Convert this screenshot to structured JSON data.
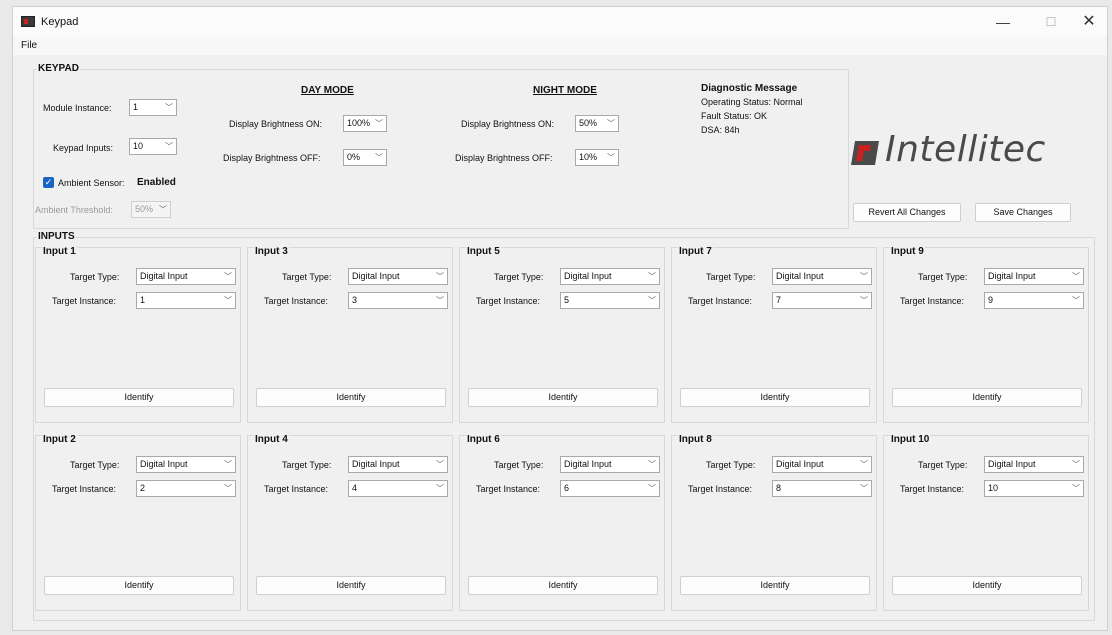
{
  "window": {
    "title": "Keypad",
    "minimize": "—",
    "maximize": "☐",
    "close": "✕"
  },
  "menu": {
    "file": "File"
  },
  "keypad": {
    "label": "KEYPAD",
    "module_instance_label": "Module Instance:",
    "module_instance_value": "1",
    "keypad_inputs_label": "Keypad Inputs:",
    "keypad_inputs_value": "10",
    "ambient_sensor_label": "Ambient Sensor:",
    "ambient_sensor_status": "Enabled",
    "ambient_threshold_label": "Ambient Threshold:",
    "ambient_threshold_value": "50%",
    "day_mode": {
      "title": "DAY MODE",
      "on_label": "Display Brightness ON:",
      "on_value": "100%",
      "off_label": "Display Brightness OFF:",
      "off_value": "0%"
    },
    "night_mode": {
      "title": "NIGHT MODE",
      "on_label": "Display Brightness ON:",
      "on_value": "50%",
      "off_label": "Display Brightness OFF:",
      "off_value": "10%"
    },
    "diagnostic": {
      "title": "Diagnostic Message",
      "operating_status": "Operating Status: Normal",
      "fault_status": "Fault Status: OK",
      "dsa": "DSA: 84h"
    }
  },
  "logo_text": "Intellitec",
  "buttons": {
    "revert": "Revert All Changes",
    "save": "Save Changes"
  },
  "inputs": {
    "label": "INPUTS",
    "target_type_label": "Target Type:",
    "target_instance_label": "Target Instance:",
    "identify_label": "Identify",
    "items": [
      {
        "title": "Input 1",
        "target_type": "Digital Input",
        "target_instance": "1"
      },
      {
        "title": "Input 2",
        "target_type": "Digital Input",
        "target_instance": "2"
      },
      {
        "title": "Input 3",
        "target_type": "Digital Input",
        "target_instance": "3"
      },
      {
        "title": "Input 4",
        "target_type": "Digital Input",
        "target_instance": "4"
      },
      {
        "title": "Input 5",
        "target_type": "Digital Input",
        "target_instance": "5"
      },
      {
        "title": "Input 6",
        "target_type": "Digital Input",
        "target_instance": "6"
      },
      {
        "title": "Input 7",
        "target_type": "Digital Input",
        "target_instance": "7"
      },
      {
        "title": "Input 8",
        "target_type": "Digital Input",
        "target_instance": "8"
      },
      {
        "title": "Input 9",
        "target_type": "Digital Input",
        "target_instance": "9"
      },
      {
        "title": "Input 10",
        "target_type": "Digital Input",
        "target_instance": "10"
      }
    ]
  },
  "icons": {
    "chevron": "chevron-down-icon",
    "check": "checkmark-icon"
  },
  "colors": {
    "accent": "#1a64c4",
    "logo_red": "#c92020",
    "logo_gray": "#4a4a4a"
  }
}
